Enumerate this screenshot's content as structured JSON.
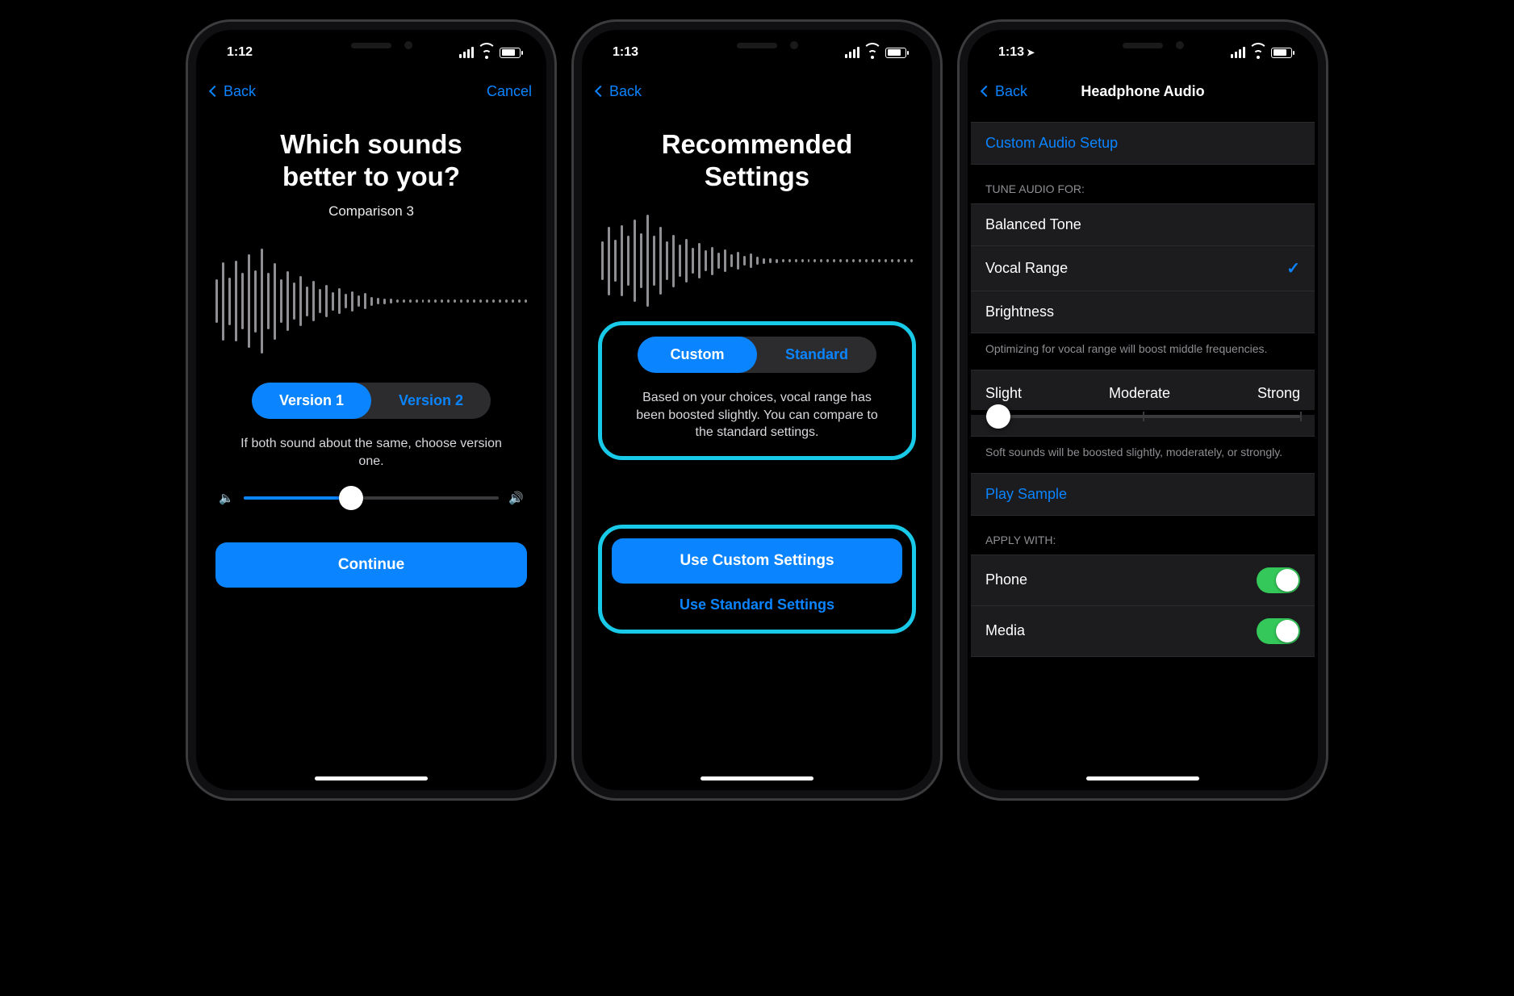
{
  "accent": "#0b84ff",
  "highlight": "#18c9e8",
  "phone1": {
    "time": "1:12",
    "back": "Back",
    "cancel": "Cancel",
    "title_line1": "Which sounds",
    "title_line2": "better to you?",
    "subtitle": "Comparison 3",
    "segment": {
      "a": "Version 1",
      "b": "Version 2",
      "selected": "a"
    },
    "hint": "If both sound about the same, choose version one.",
    "volume_percent": 42,
    "continue": "Continue"
  },
  "phone2": {
    "time": "1:13",
    "back": "Back",
    "title_line1": "Recommended",
    "title_line2": "Settings",
    "segment": {
      "a": "Custom",
      "b": "Standard",
      "selected": "a"
    },
    "hint": "Based on your choices, vocal range has been boosted slightly. You can compare to the standard settings.",
    "primary_btn": "Use Custom Settings",
    "secondary_btn": "Use Standard Settings"
  },
  "phone3": {
    "time": "1:13",
    "back": "Back",
    "title": "Headphone Audio",
    "custom_setup": "Custom Audio Setup",
    "tune_header": "TUNE AUDIO FOR:",
    "tune_options": [
      "Balanced Tone",
      "Vocal Range",
      "Brightness"
    ],
    "tune_selected_index": 1,
    "tune_footer": "Optimizing for vocal range will boost middle frequencies.",
    "extent": {
      "labels": [
        "Slight",
        "Moderate",
        "Strong"
      ],
      "value_percent": 4
    },
    "extent_footer": "Soft sounds will be boosted slightly, moderately, or strongly.",
    "play_sample": "Play Sample",
    "apply_header": "APPLY WITH:",
    "apply": [
      {
        "label": "Phone",
        "on": true
      },
      {
        "label": "Media",
        "on": true
      }
    ]
  },
  "waveform_heights": [
    54,
    97,
    59,
    100,
    70,
    116,
    77,
    130,
    70,
    95,
    54,
    74,
    46,
    62,
    37,
    50,
    30,
    40,
    23,
    32,
    18,
    25,
    14,
    20,
    11,
    8,
    7,
    6,
    5,
    5,
    5,
    5,
    4,
    4,
    4,
    4,
    4,
    4,
    4,
    4,
    4,
    4,
    4,
    4,
    4,
    4,
    4,
    4,
    4
  ]
}
